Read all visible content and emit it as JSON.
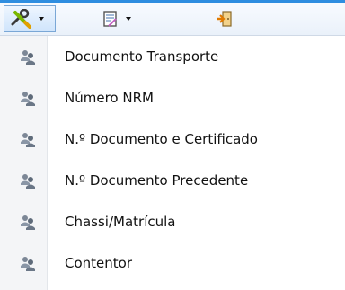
{
  "toolbar": {
    "buttons": [
      {
        "icon": "tools-icon"
      },
      {
        "icon": "document-icon"
      },
      {
        "icon": "exit-door-icon"
      }
    ]
  },
  "menu": {
    "items": [
      {
        "label": "Documento Transporte",
        "icon": "search-users-icon"
      },
      {
        "label": "Número NRM",
        "icon": "search-users-icon"
      },
      {
        "label": "N.º Documento e Certificado",
        "icon": "search-users-icon"
      },
      {
        "label": "N.º Documento Precedente",
        "icon": "search-users-icon"
      },
      {
        "label": "Chassi/Matrícula",
        "icon": "search-users-icon"
      },
      {
        "label": "Contentor",
        "icon": "search-users-icon"
      }
    ]
  }
}
